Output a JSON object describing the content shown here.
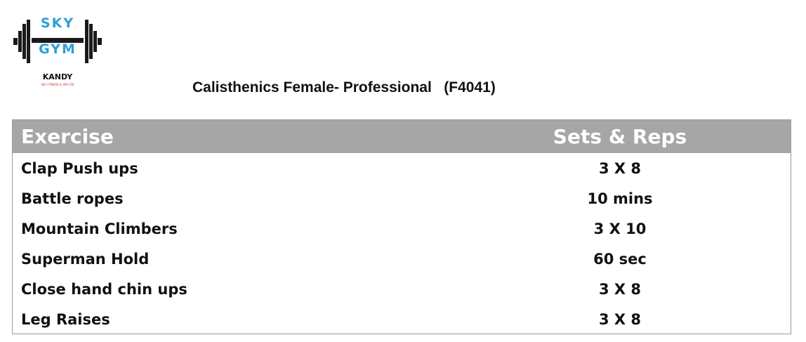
{
  "logo": {
    "line1": "SKY",
    "line2": "GYM",
    "city": "KANDY",
    "tagline": "SKY FITNESS & SPA LTD",
    "colors": {
      "accent": "#2f9fd8",
      "bar": "#1a1a1a",
      "tagline": "#c03030"
    }
  },
  "title": "Calisthenics Female- Professional   (F4041)",
  "table": {
    "headers": [
      "Exercise",
      "Sets & Reps"
    ],
    "header_color": "#a6a6a6",
    "rows": [
      [
        "Clap Push ups",
        "3 X 8"
      ],
      [
        "Battle ropes",
        "10 mins"
      ],
      [
        "Mountain Climbers",
        "3 X 10"
      ],
      [
        "Superman Hold",
        "60 sec"
      ],
      [
        "Close hand chin ups",
        "3 X 8"
      ],
      [
        "Leg Raises",
        "3 X 8"
      ]
    ]
  }
}
